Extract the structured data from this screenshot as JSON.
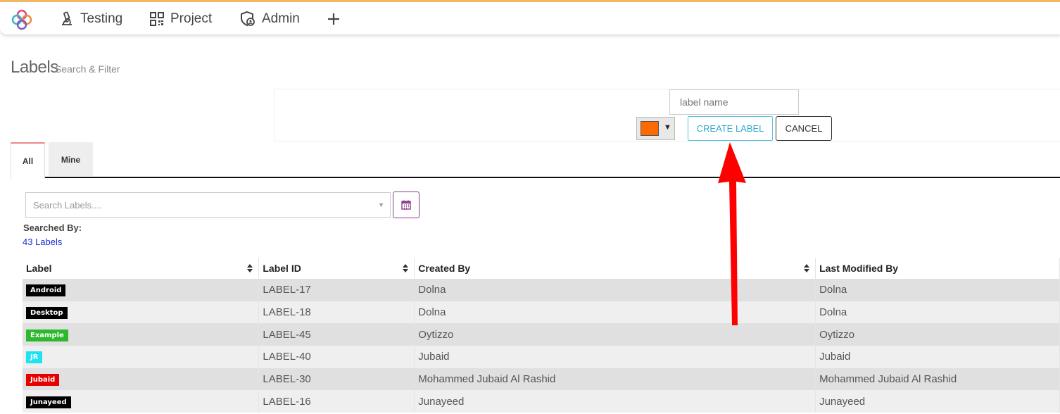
{
  "nav": {
    "items": [
      {
        "label": "Testing",
        "icon": "microscope-icon"
      },
      {
        "label": "Project",
        "icon": "qr-grid-icon"
      },
      {
        "label": "Admin",
        "icon": "shield-user-icon"
      }
    ],
    "add_icon": "plus-icon"
  },
  "page": {
    "title": "Labels",
    "subtitle": "Search & Filter"
  },
  "create_form": {
    "name_placeholder": "label name",
    "selected_color": "#ff6a00",
    "create_label": "CREATE LABEL",
    "cancel_label": "CANCEL"
  },
  "tabs": [
    {
      "label": "All",
      "active": true
    },
    {
      "label": "Mine",
      "active": false
    }
  ],
  "search": {
    "placeholder": "Search Labels....",
    "searched_by_label": "Searched By:",
    "result_count": "43 Labels"
  },
  "table": {
    "columns": [
      "Label",
      "Label ID",
      "Created By",
      "Last Modified By"
    ],
    "rows": [
      {
        "label": "Android",
        "color": "#000000",
        "id": "LABEL-17",
        "created_by": "Dolna",
        "modified_by": "Dolna"
      },
      {
        "label": "Desktop",
        "color": "#000000",
        "id": "LABEL-18",
        "created_by": "Dolna",
        "modified_by": "Dolna"
      },
      {
        "label": "Example",
        "color": "#2db82d",
        "id": "LABEL-45",
        "created_by": "Oytizzo",
        "modified_by": "Oytizzo"
      },
      {
        "label": "JR",
        "color": "#1ee3f0",
        "id": "LABEL-40",
        "created_by": "Jubaid",
        "modified_by": "Jubaid"
      },
      {
        "label": "Jubaid",
        "color": "#e60000",
        "id": "LABEL-30",
        "created_by": "Mohammed Jubaid Al Rashid",
        "modified_by": "Mohammed Jubaid Al Rashid"
      },
      {
        "label": "Junayeed",
        "color": "#000000",
        "id": "LABEL-16",
        "created_by": "Junayeed",
        "modified_by": "Junayeed"
      }
    ]
  },
  "colors": {
    "annotation_arrow": "#ff0000",
    "accent_create": "#5bc0de",
    "calendar_border": "#8a3b8f"
  }
}
